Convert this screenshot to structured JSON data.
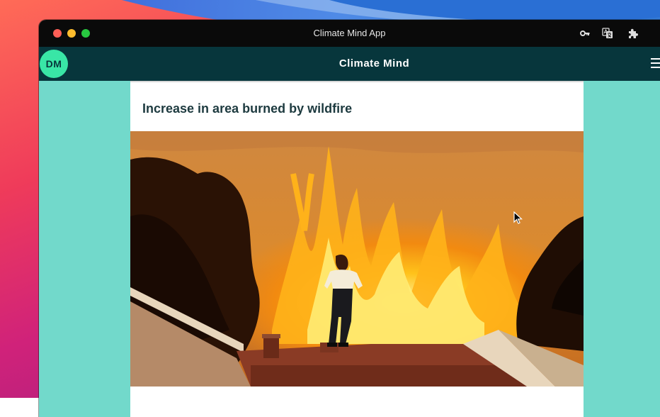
{
  "window": {
    "title": "Climate Mind App"
  },
  "toolbar_icons": [
    "key-icon",
    "translate-icon",
    "extension-puzzle-icon"
  ],
  "appbar": {
    "avatar_initials": "DM",
    "title": "Climate Mind",
    "menu_icon": "hamburger-menu-icon"
  },
  "card": {
    "title": "Increase in area burned by wildfire",
    "image_subject": "man-on-roof-watching-wildfire"
  },
  "colors": {
    "appbar_bg": "#07363c",
    "page_bg": "#72d9cb",
    "avatar_bg": "#39e6a6",
    "card_title": "#1d3a3f"
  }
}
